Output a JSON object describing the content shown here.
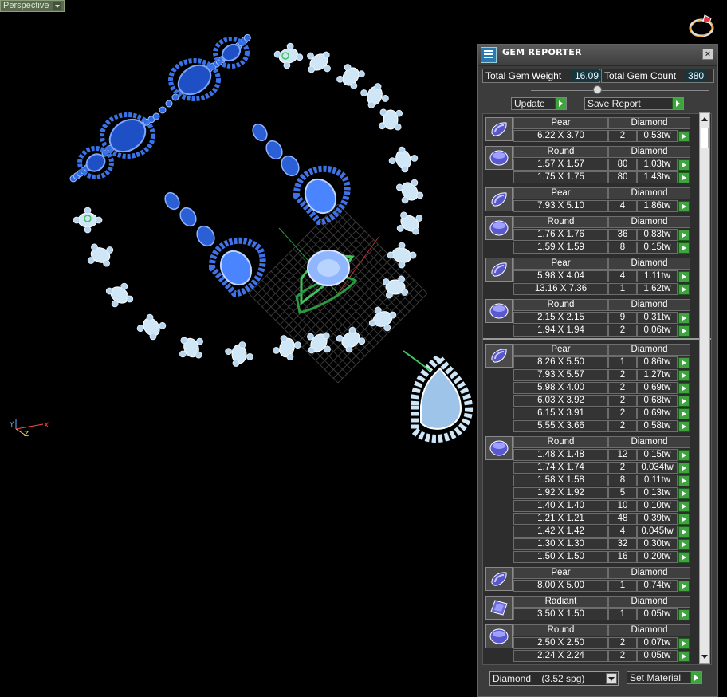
{
  "viewport": {
    "label": "Perspective",
    "axes": {
      "x": "X",
      "y": "Y",
      "z": "Z"
    }
  },
  "panel": {
    "title": "GEM REPORTER",
    "close_glyph": "×",
    "total_weight_label": "Total Gem Weight",
    "total_weight_value": "16.09",
    "total_count_label": "Total Gem Count",
    "total_count_value": "380",
    "update_label": "Update",
    "save_report_label": "Save Report",
    "material_select": "Diamond    (3.52 spg)",
    "set_material_label": "Set Material"
  },
  "gems": [
    {
      "shape": "Pear",
      "material": "Diamond",
      "rows": [
        {
          "size": "6.22 X 3.70",
          "count": "2",
          "weight": "0.53tw"
        }
      ]
    },
    {
      "shape": "Round",
      "material": "Diamond",
      "rows": [
        {
          "size": "1.57 X 1.57",
          "count": "80",
          "weight": "1.03tw"
        },
        {
          "size": "1.75 X 1.75",
          "count": "80",
          "weight": "1.43tw"
        }
      ]
    },
    {
      "shape": "Pear",
      "material": "Diamond",
      "rows": [
        {
          "size": "7.93 X 5.10",
          "count": "4",
          "weight": "1.86tw"
        }
      ]
    },
    {
      "shape": "Round",
      "material": "Diamond",
      "rows": [
        {
          "size": "1.76 X 1.76",
          "count": "36",
          "weight": "0.83tw"
        },
        {
          "size": "1.59 X 1.59",
          "count": "8",
          "weight": "0.15tw"
        }
      ]
    },
    {
      "shape": "Pear",
      "material": "Diamond",
      "rows": [
        {
          "size": "5.98 X 4.04",
          "count": "4",
          "weight": "1.11tw"
        },
        {
          "size": "13.16 X 7.36",
          "count": "1",
          "weight": "1.62tw"
        }
      ]
    },
    {
      "shape": "Round",
      "material": "Diamond",
      "rows": [
        {
          "size": "2.15 X 2.15",
          "count": "9",
          "weight": "0.31tw"
        },
        {
          "size": "1.94 X 1.94",
          "count": "2",
          "weight": "0.06tw"
        }
      ]
    },
    {
      "shape": "Pear",
      "material": "Diamond",
      "rows": [
        {
          "size": "8.26 X 5.50",
          "count": "1",
          "weight": "0.86tw"
        },
        {
          "size": "7.93 X 5.57",
          "count": "2",
          "weight": "1.27tw"
        },
        {
          "size": "5.98 X 4.00",
          "count": "2",
          "weight": "0.69tw"
        },
        {
          "size": "6.03 X 3.92",
          "count": "2",
          "weight": "0.68tw"
        },
        {
          "size": "6.15 X 3.91",
          "count": "2",
          "weight": "0.69tw"
        },
        {
          "size": "5.55 X 3.66",
          "count": "2",
          "weight": "0.58tw"
        }
      ]
    },
    {
      "shape": "Round",
      "material": "Diamond",
      "rows": [
        {
          "size": "1.48 X 1.48",
          "count": "12",
          "weight": "0.15tw"
        },
        {
          "size": "1.74 X 1.74",
          "count": "2",
          "weight": "0.034tw"
        },
        {
          "size": "1.58 X 1.58",
          "count": "8",
          "weight": "0.11tw"
        },
        {
          "size": "1.92 X 1.92",
          "count": "5",
          "weight": "0.13tw"
        },
        {
          "size": "1.40 X 1.40",
          "count": "10",
          "weight": "0.10tw"
        },
        {
          "size": "1.21 X 1.21",
          "count": "48",
          "weight": "0.39tw"
        },
        {
          "size": "1.42 X 1.42",
          "count": "4",
          "weight": "0.045tw"
        },
        {
          "size": "1.30 X 1.30",
          "count": "32",
          "weight": "0.30tw"
        },
        {
          "size": "1.50 X 1.50",
          "count": "16",
          "weight": "0.20tw"
        }
      ]
    },
    {
      "shape": "Pear",
      "material": "Diamond",
      "rows": [
        {
          "size": "8.00 X 5.00",
          "count": "1",
          "weight": "0.74tw"
        }
      ]
    },
    {
      "shape": "Radiant",
      "material": "Diamond",
      "rows": [
        {
          "size": "3.50 X 1.50",
          "count": "1",
          "weight": "0.05tw"
        }
      ]
    },
    {
      "shape": "Round",
      "material": "Diamond",
      "rows": [
        {
          "size": "2.50 X 2.50",
          "count": "2",
          "weight": "0.07tw"
        },
        {
          "size": "2.24 X 2.24",
          "count": "2",
          "weight": "0.05tw"
        }
      ]
    }
  ],
  "colors": {
    "accent_green": "#3fa33f",
    "sapphire": "#1f4fc4",
    "diamond": "#cfe6f7",
    "metal_green": "#3ec45a"
  }
}
